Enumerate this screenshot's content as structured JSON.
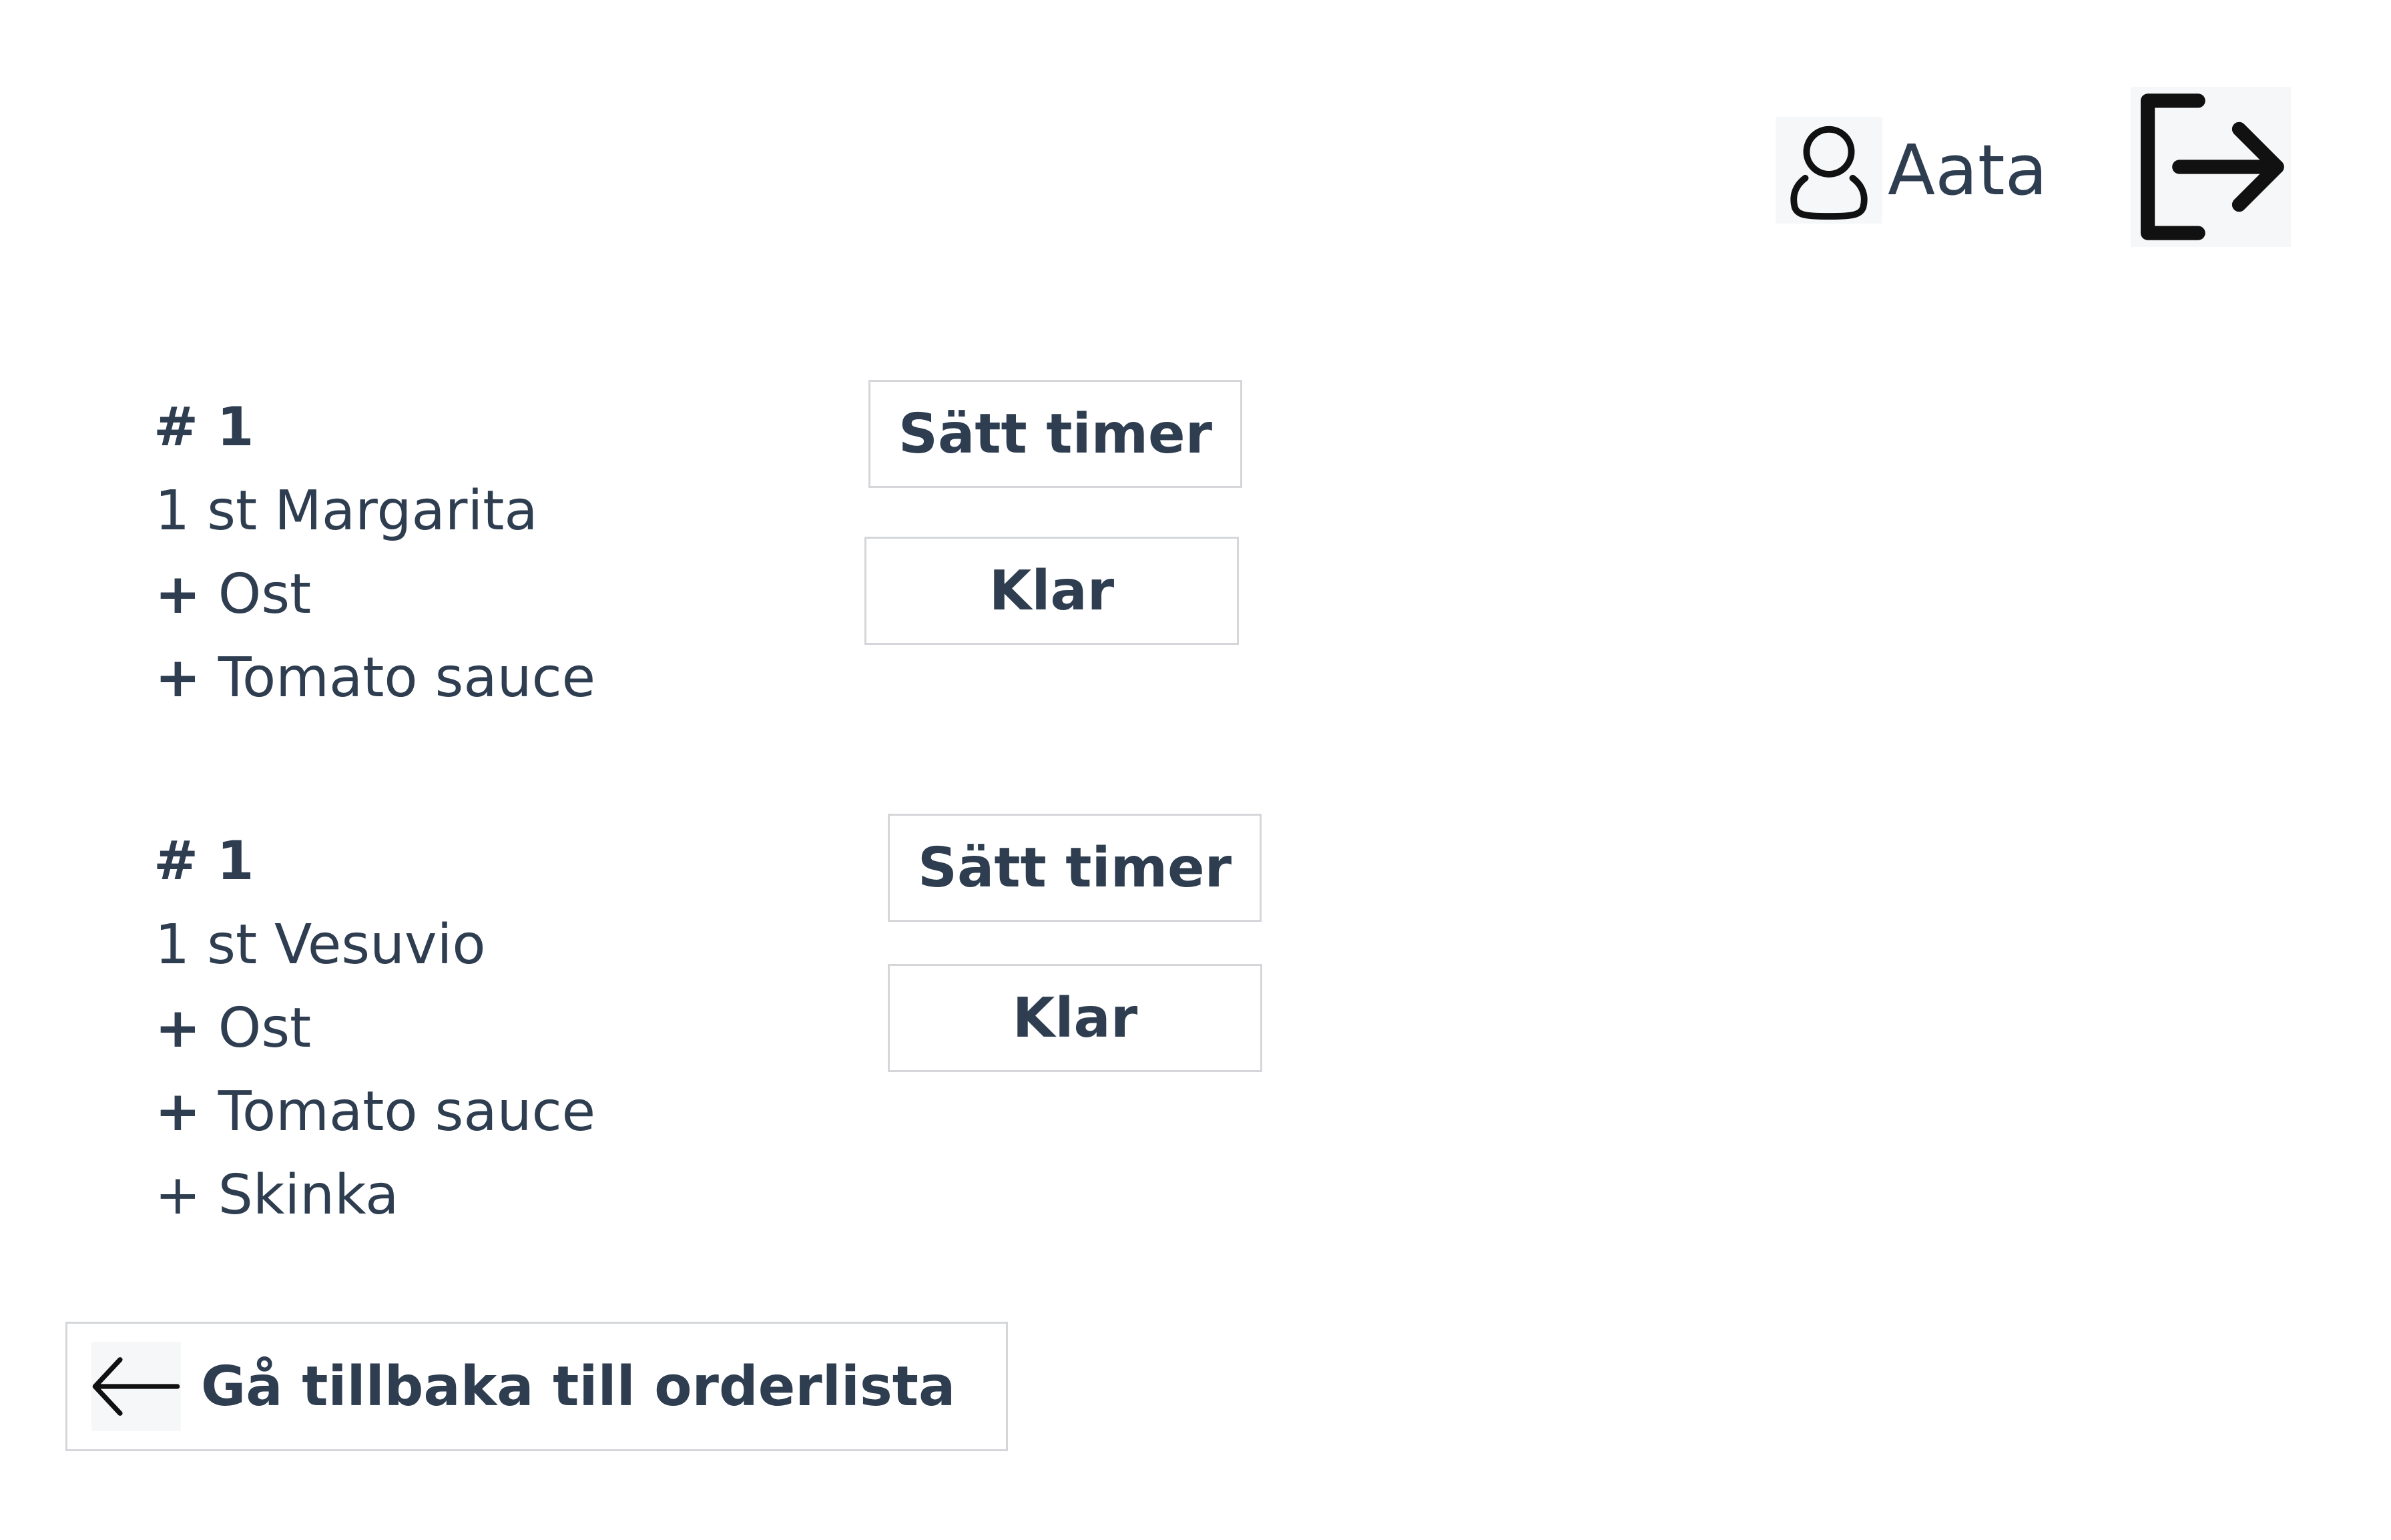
{
  "header": {
    "username": "Aata",
    "user_icon": "user-icon",
    "logout_icon": "logout-icon"
  },
  "orders": [
    {
      "number": "# 1",
      "item": "1 st Margarita",
      "toppings": [
        {
          "prefix": "+",
          "name": "Ost"
        },
        {
          "prefix": "+",
          "name": "Tomato sauce"
        }
      ],
      "timer_label": "Sätt timer",
      "done_label": "Klar"
    },
    {
      "number": "# 1",
      "item": "1 st Vesuvio",
      "toppings": [
        {
          "prefix": "+",
          "name": "Ost"
        },
        {
          "prefix": "+",
          "name": "Tomato sauce"
        },
        {
          "prefix": "+",
          "name": "Skinka"
        }
      ],
      "timer_label": "Sätt timer",
      "done_label": "Klar"
    }
  ],
  "footer": {
    "back_label": "Gå tillbaka till orderlista",
    "back_icon": "arrow-left-icon"
  },
  "colors": {
    "text": "#2e3e50",
    "border": "#d4d6d9",
    "icon": "#111111"
  }
}
